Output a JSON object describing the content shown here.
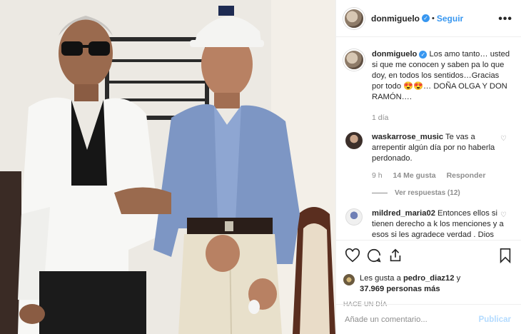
{
  "header": {
    "username": "donmiguelo",
    "separator": "•",
    "follow_label": "Seguir",
    "more_label": "•••"
  },
  "caption": {
    "username": "donmiguelo",
    "text": "Los amo tanto… usted si que me conocen y saben pa lo que doy, en todos los sentidos…Gracias por todo 😍😍… DOÑA OLGA Y DON RAMÓN….",
    "time": "1 día"
  },
  "comments": [
    {
      "username": "waskarrose_music",
      "text": "Te vas a arrepentir algún día por no haberla perdonado.",
      "time": "9 h",
      "likes": "14 Me gusta",
      "reply_label": "Responder",
      "view_replies": "Ver respuestas (12)"
    },
    {
      "username": "mildred_maria02",
      "text": "Entonces ellos si tienen derecho a k los menciones y a esos si les agradece verdad . Dios esta hay y tu madre biológica"
    }
  ],
  "likes": {
    "prefix": "Les gusta a",
    "user": "pedro_diaz12",
    "joiner": "y",
    "others": "37.969 personas más"
  },
  "posted_ago": "HACE UN DÍA",
  "add_comment": {
    "placeholder": "Añade un comentario...",
    "publish_label": "Publicar"
  },
  "icons": {
    "like": "heart-icon",
    "comment": "comment-icon",
    "share": "share-icon",
    "save": "bookmark-icon",
    "verified": "verified-badge-icon",
    "small_like": "small-heart-icon"
  },
  "colors": {
    "accent": "#3897f0",
    "publish_disabled": "#b3dbff",
    "muted_text": "#8e8e8e",
    "border": "#efefef"
  }
}
